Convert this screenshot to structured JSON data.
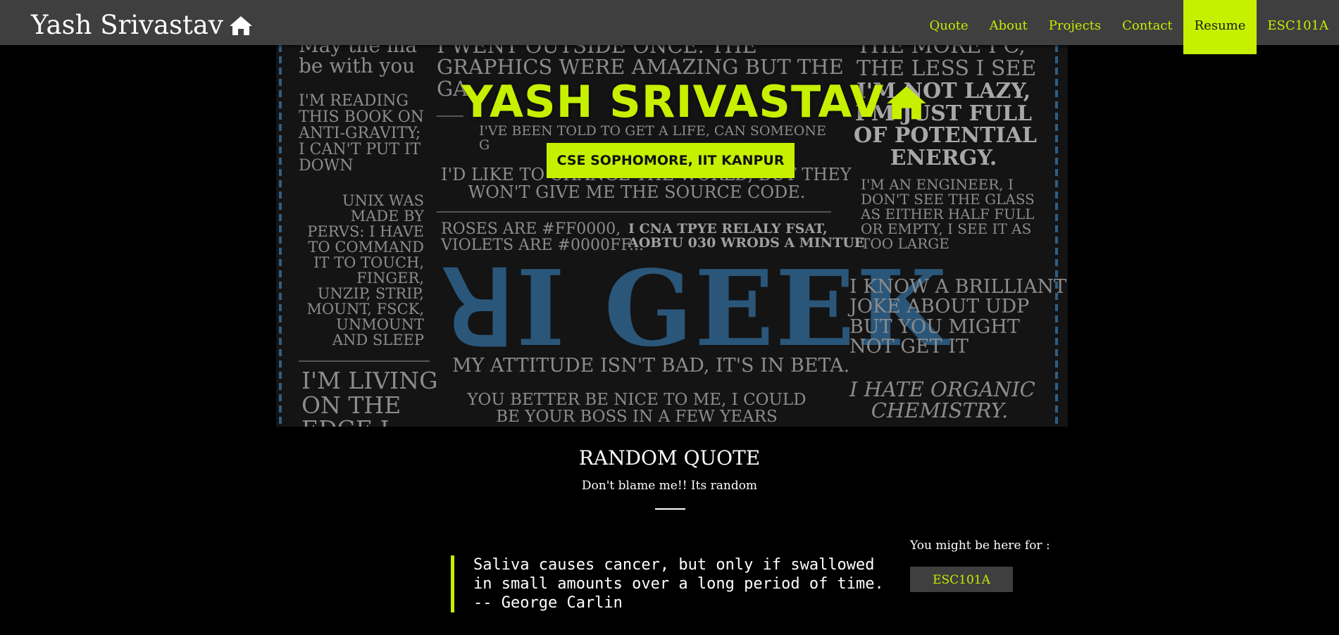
{
  "navbar": {
    "brand": "Yash Srivastav",
    "items": [
      {
        "label": "Quote"
      },
      {
        "label": "About"
      },
      {
        "label": "Projects"
      },
      {
        "label": "Contact"
      },
      {
        "label": "Resume"
      },
      {
        "label": "ESC101A"
      }
    ],
    "active_item": "Resume"
  },
  "hero": {
    "title": "YASH SRIVASTAV",
    "badge": "CSE SOPHOMORE, IIT KANPUR",
    "background_text": {
      "left_1": "May the ma\nbe with you",
      "left_2": "I'M READING\nTHIS BOOK ON\nANTI-GRAVITY;\nI CAN'T PUT IT\nDOWN",
      "left_3": "UNIX WAS\nMADE BY\nPERVS: I HAVE\nTO COMMAND\nIT TO TOUCH,\nFINGER,\nUNZIP, STRIP,\nMOUNT, FSCK,\nUNMOUNT\nAND SLEEP",
      "left_4": "I'M LIVING\nON THE\nEDGE I",
      "center_1": "I WENT OUTSIDE ONCE. THE\nGRAPHICS WERE AMAZING BUT THE\nGA",
      "center_2": "I'VE BEEN TOLD TO GET A LIFE, CAN SOMEONE\nG",
      "center_3": "I'D LIKE TO CHANGE THE WORLD, BUT THEY\nWON'T GIVE ME THE SOURCE CODE.",
      "center_4": "ROSES ARE #FF0000,\nVIOLETS ARE #0000FF...",
      "center_5": "I CNA TPYE RELALY FSAT,\nAOBTU 030 WRODS A MINTUE",
      "center_geek": "ꓤI GEEK",
      "center_6": "MY ATTITUDE ISN'T BAD, IT'S IN BETA.",
      "center_7": "YOU BETTER BE NICE TO ME, I COULD\nBE YOUR BOSS IN A FEW YEARS",
      "right_1": "THE MORE I C,\nTHE LESS I SEE",
      "right_2": "I'M NOT LAZY,\nI'M JUST FULL\nOF POTENTIAL\nENERGY.",
      "right_3": "I'M AN ENGINEER, I\nDON'T SEE THE GLASS\nAS EITHER HALF FULL\nOR EMPTY, I SEE IT AS\nTOO LARGE",
      "right_4": "I KNOW A BRILLIANT\nJOKE ABOUT UDP\nBUT YOU MIGHT\nNOT GET IT",
      "right_5": "I HATE ORGANIC\nCHEMISTRY."
    }
  },
  "quote_section": {
    "title": "RANDOM QUOTE",
    "subtitle": "Don't blame me!! Its random",
    "quote": "Saliva causes cancer, but only if swallowed in small amounts over a long period of time. -- George Carlin"
  },
  "sidebar": {
    "label": "You might be here for :",
    "button": "ESC101A"
  },
  "colors": {
    "accent": "#c6f000",
    "navbar_bg": "#3f3f3f",
    "page_bg": "#000000"
  }
}
